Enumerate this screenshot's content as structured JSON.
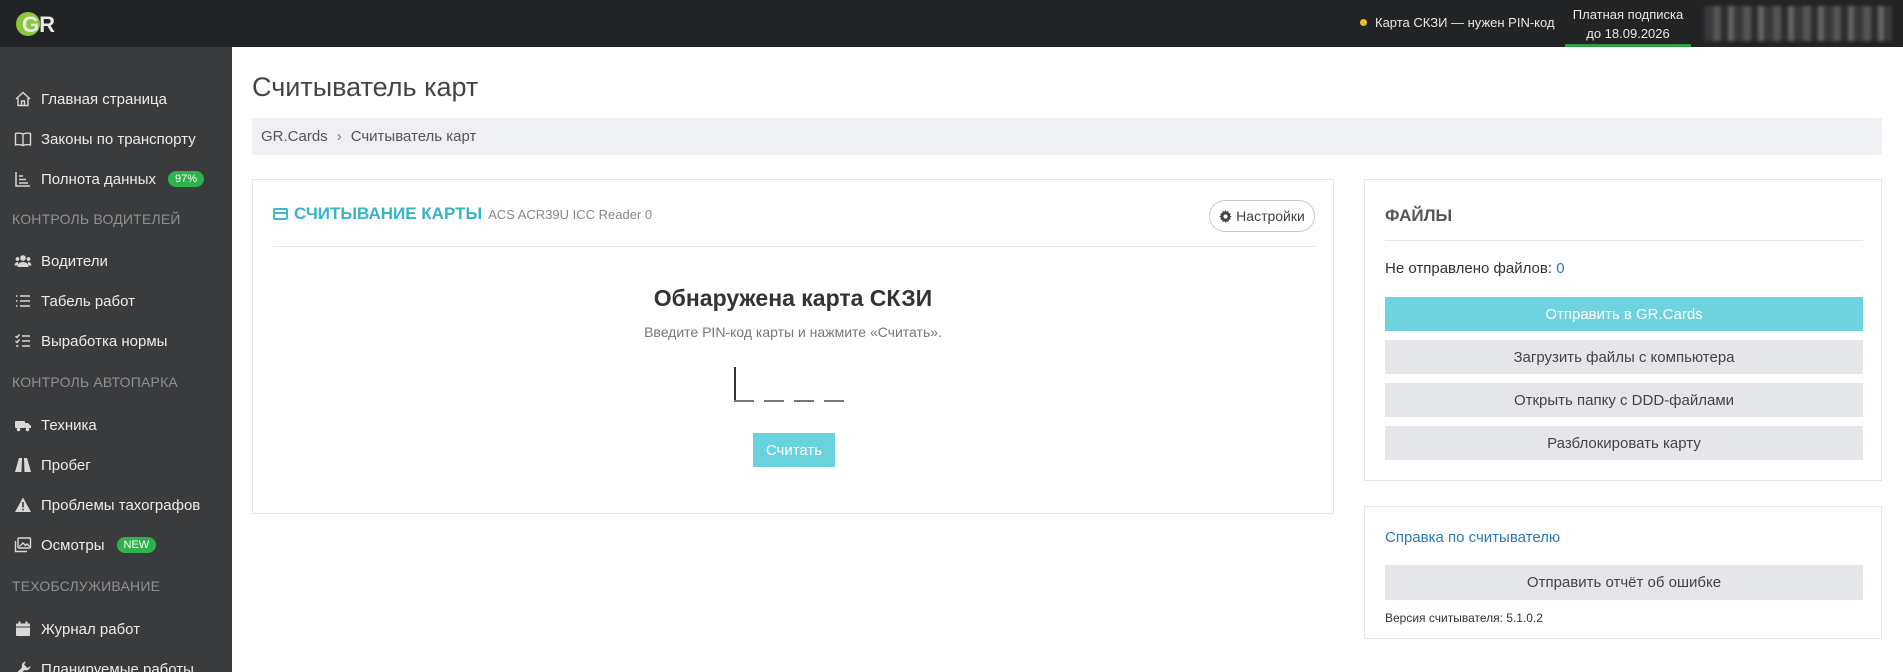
{
  "topbar": {
    "logo_text": "GR",
    "card_status": "Карта СКЗИ — нужен PIN-код",
    "subscription_line1": "Платная подписка",
    "subscription_line2": "до 18.09.2026",
    "colors": {
      "status_dot": "#f2c01b",
      "subscription_bar": "#2ea043"
    }
  },
  "sidebar": {
    "items": [
      {
        "label": "Главная страница",
        "icon": "home-icon"
      },
      {
        "label": "Законы по транспорту",
        "icon": "book-icon"
      },
      {
        "label": "Полнота данных",
        "icon": "chart-icon",
        "badge": "97%"
      },
      {
        "label": "Водители",
        "icon": "users-icon"
      },
      {
        "label": "Табель работ",
        "icon": "list-icon"
      },
      {
        "label": "Выработка нормы",
        "icon": "checklist-icon"
      },
      {
        "label": "Техника",
        "icon": "truck-icon"
      },
      {
        "label": "Пробег",
        "icon": "road-icon"
      },
      {
        "label": "Проблемы тахографов",
        "icon": "warning-icon"
      },
      {
        "label": "Осмотры",
        "icon": "images-icon",
        "badge": "NEW"
      },
      {
        "label": "Журнал работ",
        "icon": "calendar-icon"
      },
      {
        "label": "Планируемые работы",
        "icon": "wrench-icon"
      }
    ],
    "sections": [
      "Контроль водителей",
      "Контроль автопарка",
      "Техобслуживание"
    ]
  },
  "main": {
    "title": "Считыватель карт",
    "breadcrumb": [
      "GR.Cards",
      "Считыватель карт"
    ]
  },
  "card_reader": {
    "title": "СЧИТЫВАНИЕ КАРТЫ",
    "device": "ACS ACR39U ICC Reader 0",
    "settings_label": "Настройки",
    "detected": "Обнаружена карта СКЗИ",
    "hint": "Введите PIN-код карты и нажмите «Считать».",
    "read_label": "Считать",
    "accent": "#37b5c6"
  },
  "files": {
    "title": "ФАЙЛЫ",
    "not_sent_label": "Не отправлено файлов:",
    "not_sent_count": "0",
    "buttons": {
      "send": "Отправить в GR.Cards",
      "upload": "Загрузить файлы с компьютера",
      "open_folder": "Открыть папку с DDD-файлами",
      "unlock": "Разблокировать карту"
    }
  },
  "help": {
    "link": "Справка по считывателю",
    "report_label": "Отправить отчёт об ошибке",
    "version": "Версия считывателя: 5.1.0.2"
  }
}
